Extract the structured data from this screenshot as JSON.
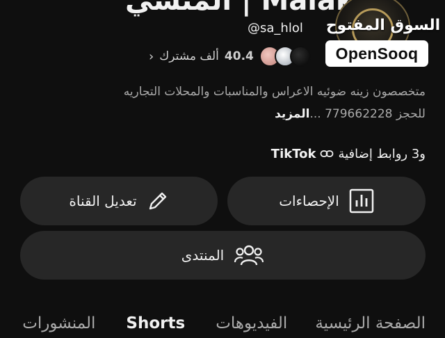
{
  "channel": {
    "name_partial": "المنسي | Malaki",
    "handle": "@sa_hlol"
  },
  "subscribers": {
    "count": "40.4",
    "label": "ألف مشترك",
    "chevron": "›"
  },
  "watermark": {
    "arabic": "السوق المفتوح",
    "latin": "OpenSooq"
  },
  "description": {
    "line1": "متخصصون زينه ضوئيه الاعراس والمناسبات والمحلات التجاريه",
    "line2": "للحجز 779662228 ...",
    "more": "المزيد"
  },
  "links": {
    "primary": "TikTok",
    "extra": "و3 روابط إضافية",
    "icon": "link-icon"
  },
  "buttons": {
    "analytics": {
      "label": "الإحصاءات",
      "icon": "bar-chart-icon"
    },
    "edit": {
      "label": "تعديل القناة",
      "icon": "pencil-icon"
    },
    "community": {
      "label": "المنتدى",
      "icon": "people-icon"
    }
  },
  "tabs": [
    {
      "label": "الصفحة الرئيسية",
      "selected": false
    },
    {
      "label": "الفيديوهات",
      "selected": false
    },
    {
      "label": "Shorts",
      "selected": true
    },
    {
      "label": "المنشورات",
      "selected": false
    }
  ]
}
